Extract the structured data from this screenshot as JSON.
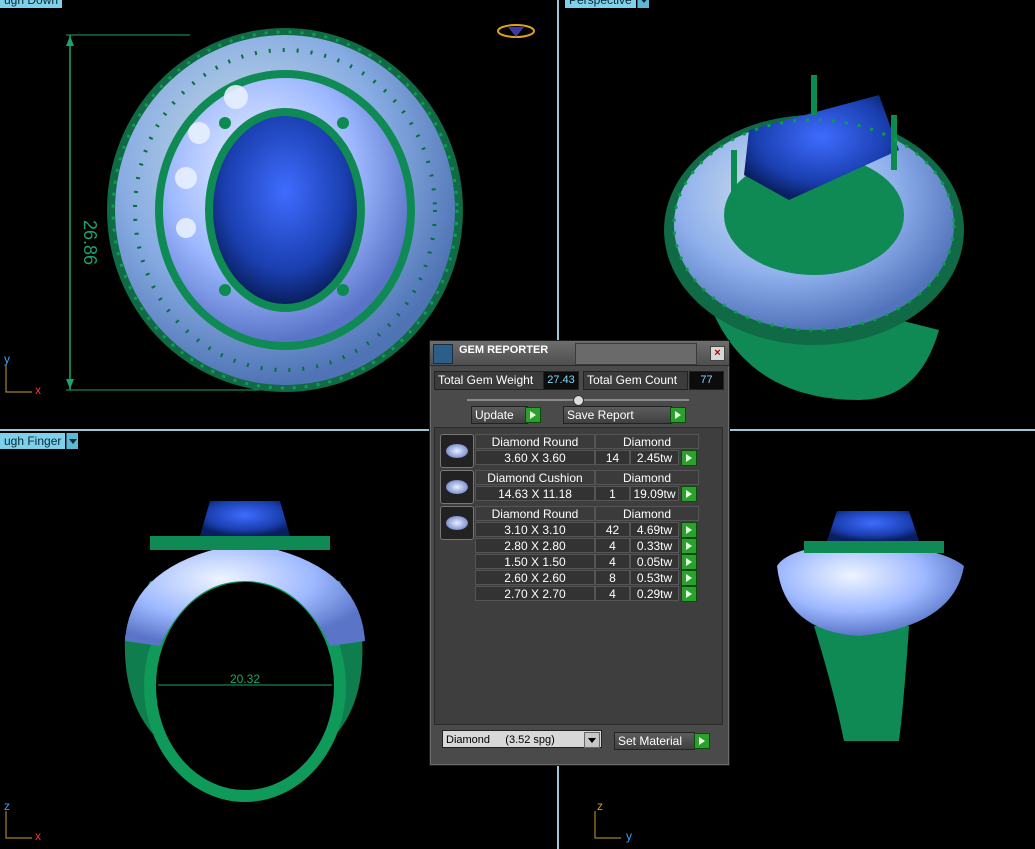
{
  "viewports": {
    "top": {
      "label": "ugh Down"
    },
    "perspective": {
      "label": "Perspective"
    },
    "front": {
      "label": "ugh Finger"
    },
    "side": {
      "label": ""
    }
  },
  "dimensions": {
    "height": "26.86",
    "width": "20.32"
  },
  "axes": {
    "x": "x",
    "y": "y",
    "z": "z"
  },
  "gem_reporter": {
    "title": "GEM REPORTER",
    "total_gem_weight_label": "Total Gem Weight",
    "total_gem_weight_value": "27.43",
    "total_gem_count_label": "Total Gem Count",
    "total_gem_count_value": "77",
    "update_label": "Update",
    "save_report_label": "Save Report",
    "groups": [
      {
        "name": "Diamond Round",
        "material": "Diamond",
        "rows": [
          {
            "size": "3.60 X 3.60",
            "count": "14",
            "weight": "2.45tw"
          }
        ]
      },
      {
        "name": "Diamond Cushion",
        "material": "Diamond",
        "rows": [
          {
            "size": "14.63 X 11.18",
            "count": "1",
            "weight": "19.09tw"
          }
        ]
      },
      {
        "name": "Diamond Round",
        "material": "Diamond",
        "rows": [
          {
            "size": "3.10 X 3.10",
            "count": "42",
            "weight": "4.69tw"
          },
          {
            "size": "2.80 X 2.80",
            "count": "4",
            "weight": "0.33tw"
          },
          {
            "size": "1.50 X 1.50",
            "count": "4",
            "weight": "0.05tw"
          },
          {
            "size": "2.60 X 2.60",
            "count": "8",
            "weight": "0.53tw"
          },
          {
            "size": "2.70 X 2.70",
            "count": "4",
            "weight": "0.29tw"
          }
        ]
      }
    ],
    "material_select_value": "Diamond     (3.52 spg)",
    "set_material_label": "Set Material"
  },
  "colors": {
    "metal": "#0f8a55",
    "stone": "#1a3fb0",
    "pave": "#9db8ff",
    "viewport_label": "#7fd0ea"
  }
}
